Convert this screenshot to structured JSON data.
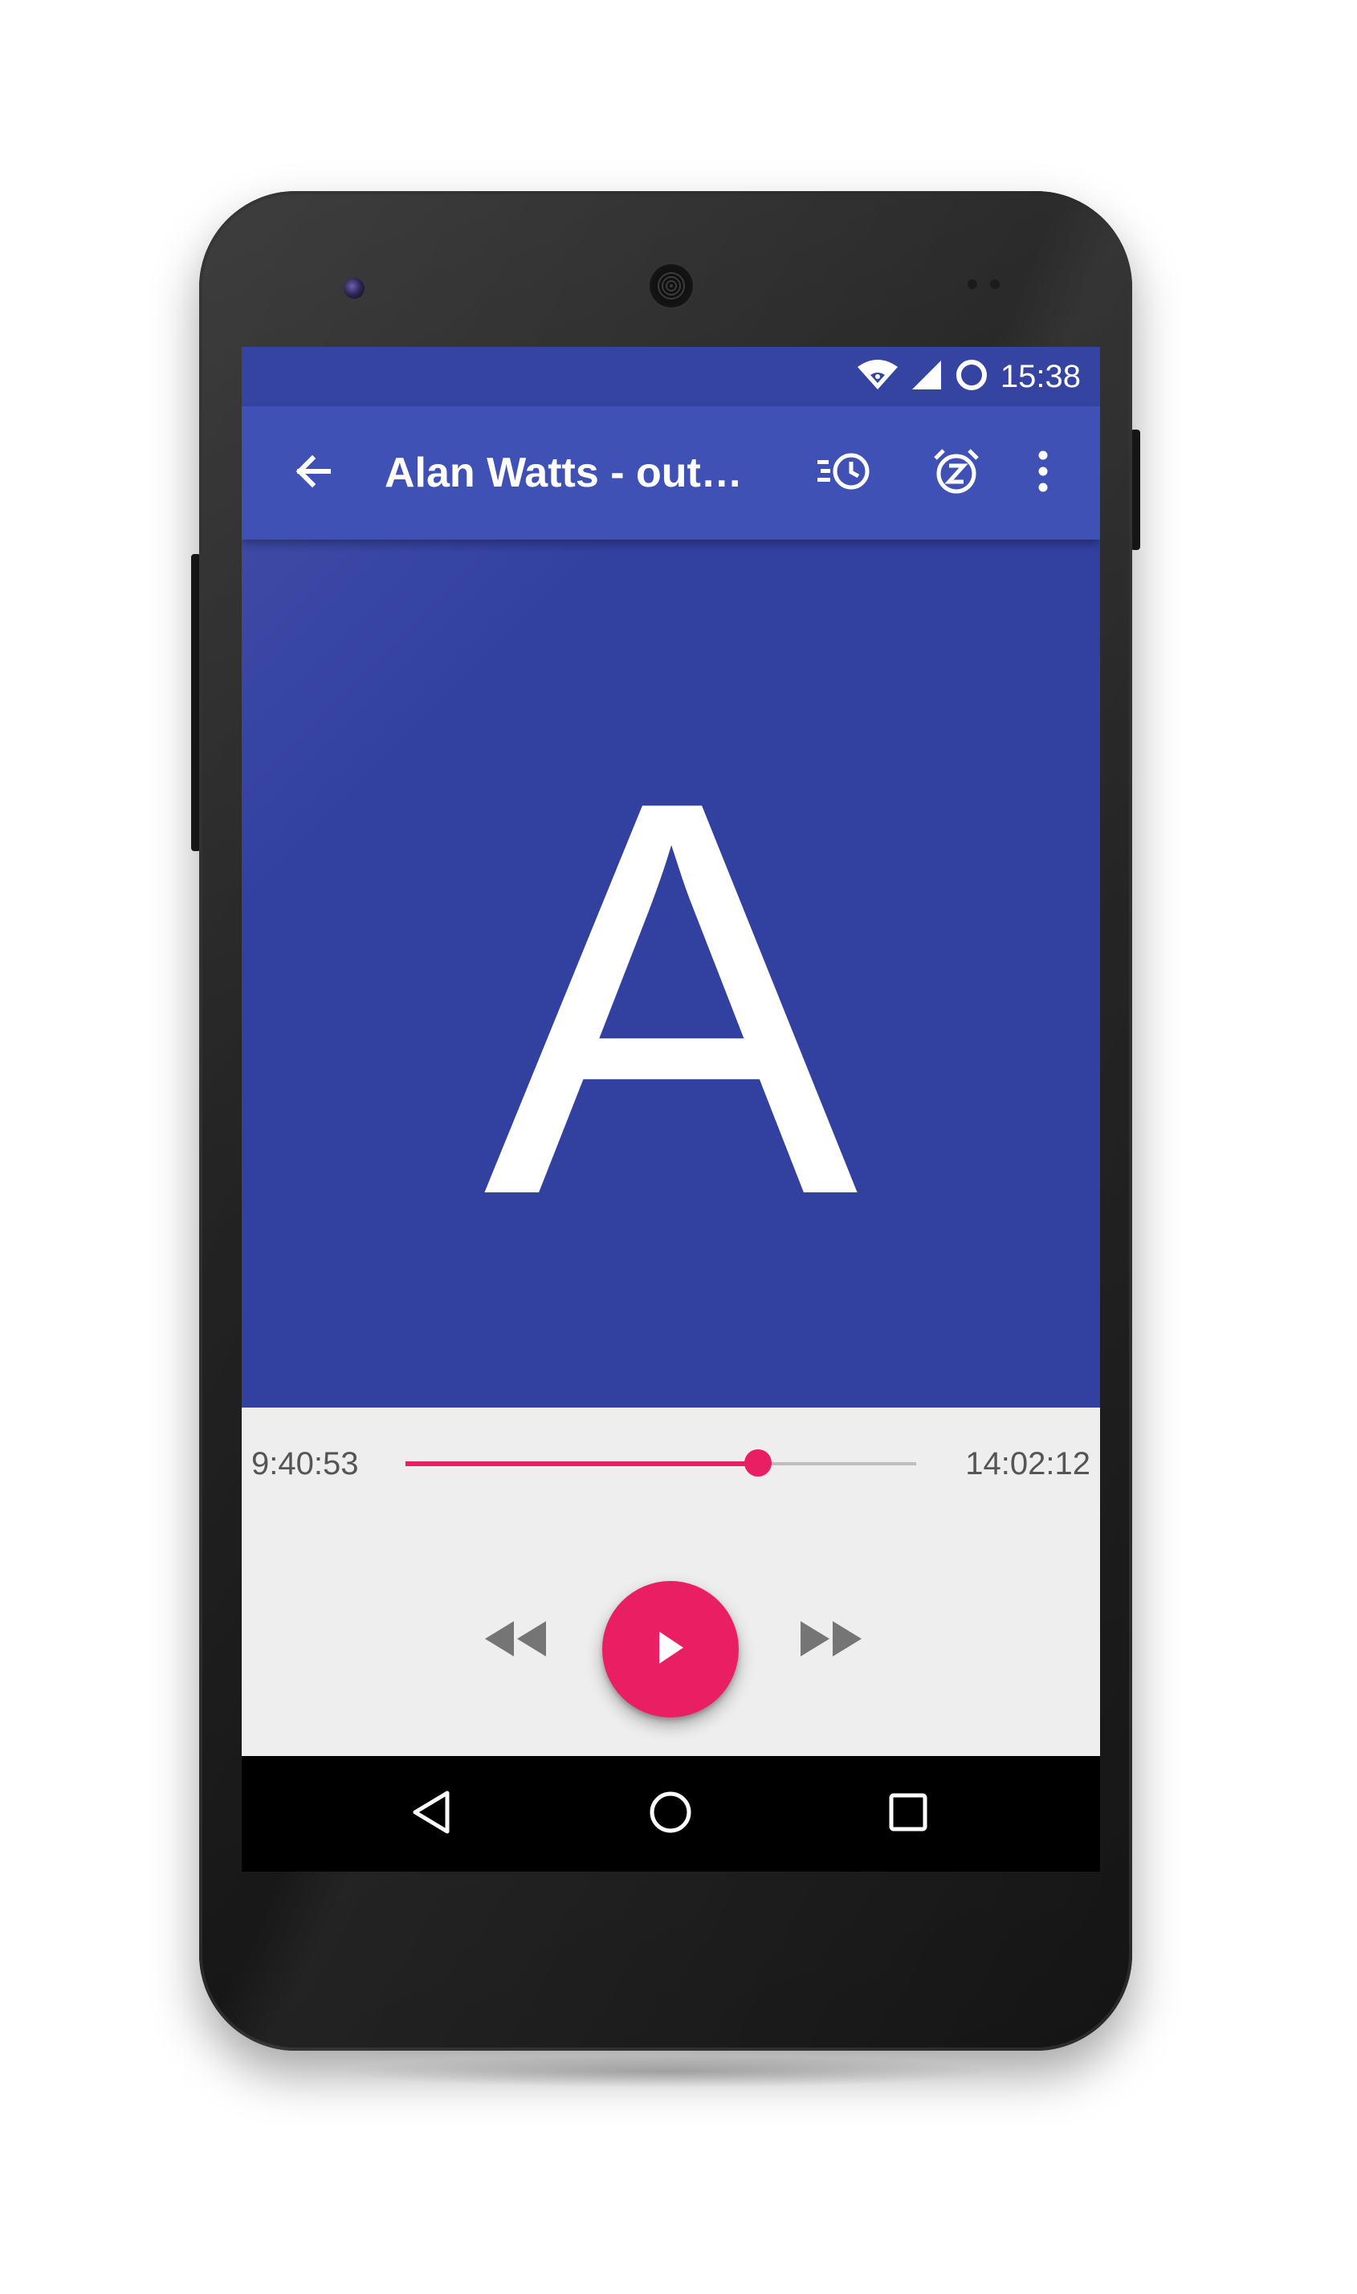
{
  "status_bar": {
    "time": "15:38",
    "icons": [
      "wifi-icon",
      "cell-signal-icon",
      "data-saver-icon"
    ]
  },
  "toolbar": {
    "back_icon": "arrow-back-icon",
    "title": "Alan Watts - out…",
    "actions": [
      "playback-speed-icon",
      "sleep-timer-icon",
      "more-vert-icon"
    ]
  },
  "cover": {
    "letter": "A",
    "background_color": "#3240a0"
  },
  "player": {
    "elapsed": "9:40:53",
    "total": "14:02:12",
    "progress": 0.69,
    "accent_color": "#e91e63",
    "controls": [
      "rewind-icon",
      "play-icon",
      "fast-forward-icon"
    ]
  },
  "nav_bar": {
    "buttons": [
      "back-triangle-icon",
      "home-circle-icon",
      "recents-square-icon"
    ]
  }
}
